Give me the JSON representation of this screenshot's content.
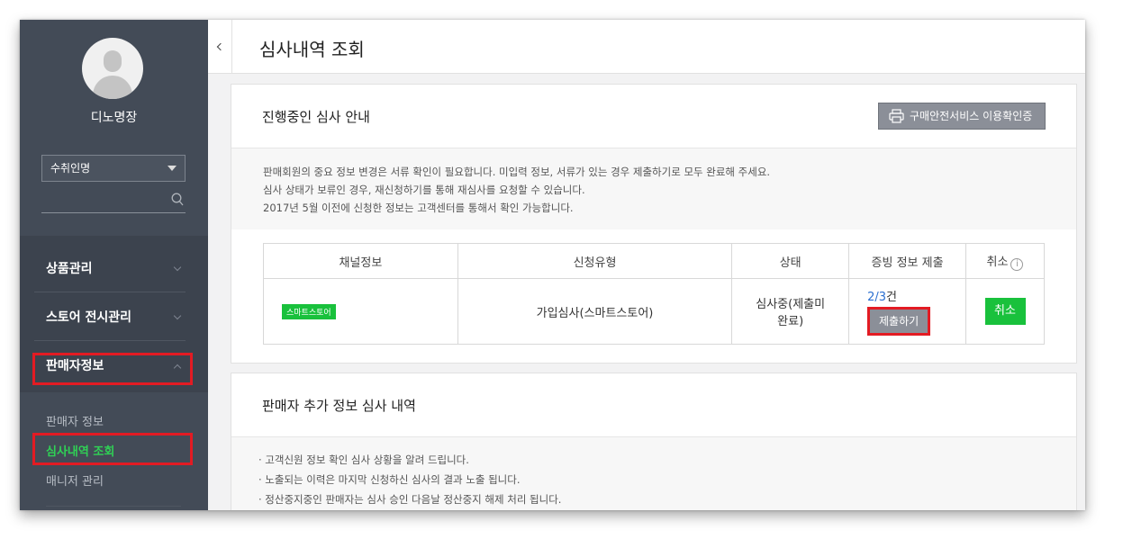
{
  "sidebar": {
    "seller_name": "디노명장",
    "select_value": "수취인명",
    "menu": [
      {
        "label": "상품관리"
      },
      {
        "label": "스토어 전시관리"
      },
      {
        "label": "판매자정보"
      }
    ],
    "submenu": [
      {
        "label": "판매자 정보"
      },
      {
        "label": "심사내역 조회"
      },
      {
        "label": "매니저 관리"
      }
    ]
  },
  "header": {
    "title": "심사내역 조회"
  },
  "progress_panel": {
    "title": "진행중인 심사 안내",
    "guide_button": "구매안전서비스 이용확인증",
    "notices": [
      "판매회원의 중요 정보 변경은 서류 확인이 필요합니다. 미입력 정보, 서류가 있는 경우 제출하기로 모두 완료해 주세요.",
      "심사 상태가 보류인 경우, 재신청하기를 통해 재심사를 요청할 수 있습니다.",
      "2017년 5월 이전에 신청한 정보는 고객센터를 통해서 확인 가능합니다."
    ],
    "table": {
      "headers": [
        "채널정보",
        "신청유형",
        "상태",
        "증빙 정보 제출",
        "취소"
      ],
      "row": {
        "channel_badge": "스마트스토어",
        "type": "가입심사(스마트스토어)",
        "status_line1": "심사중(제출미",
        "status_line2": "완료)",
        "proof_count": "2/3",
        "proof_suffix": "건",
        "submit_label": "제출하기",
        "cancel_label": "취소"
      }
    }
  },
  "extra_panel": {
    "title": "판매자 추가 정보 심사 내역",
    "bullets": [
      "· 고객신원 정보 확인 심사 상황을 알려 드립니다.",
      "· 노출되는 이력은 마지막 신청하신 심사의 결과 노출 됩니다.",
      "· 정산중지중인 판매자는 심사 승인 다음날 정산중지 해제 처리 됩니다."
    ]
  },
  "colors": {
    "sidebar_bg": "#434b57",
    "accent_green": "#19c13c",
    "highlight_red": "#e31b23",
    "link_blue": "#2a6fd0"
  }
}
